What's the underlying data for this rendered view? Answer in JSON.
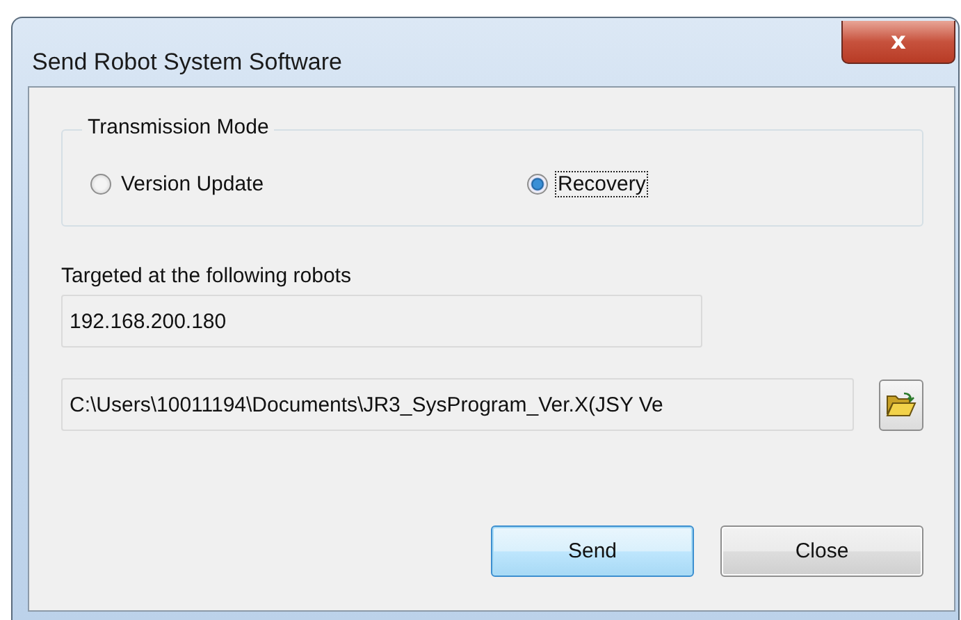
{
  "window": {
    "title": "Send Robot System Software",
    "close_label": "x"
  },
  "transmission_mode": {
    "title": "Transmission Mode",
    "options": [
      {
        "label": "Version Update",
        "selected": false,
        "focused": false
      },
      {
        "label": "Recovery",
        "selected": true,
        "focused": true
      }
    ]
  },
  "targets": {
    "label": "Targeted at the following robots",
    "value": "192.168.200.180"
  },
  "file_path": {
    "value": "C:\\Users\\10011194\\Documents\\JR3_SysProgram_Ver.X(JSY Ve"
  },
  "buttons": [
    {
      "label": "Send",
      "default": true
    },
    {
      "label": "Close",
      "default": false
    }
  ]
}
